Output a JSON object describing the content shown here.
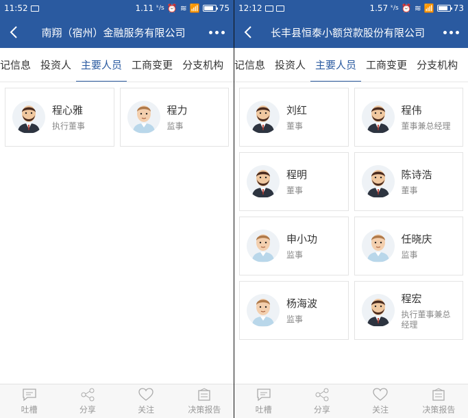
{
  "left": {
    "status": {
      "time": "11:52",
      "speed": "1.11",
      "battery": "75"
    },
    "nav": {
      "title": "南翔（宿州）金融服务有限公司"
    },
    "tabs": [
      "记信息",
      "投资人",
      "主要人员",
      "工商变更",
      "分支机构"
    ],
    "active_tab": "主要人员",
    "people": [
      {
        "name": "程心雅",
        "role": "执行董事",
        "avatar": "bearded-man-avatar-icon"
      },
      {
        "name": "程力",
        "role": "监事",
        "avatar": "young-man-avatar-icon"
      }
    ]
  },
  "right": {
    "status": {
      "time": "12:12",
      "speed": "1.57",
      "battery": "73"
    },
    "nav": {
      "title": "长丰县恒泰小额贷款股份有限公司"
    },
    "tabs": [
      "记信息",
      "投资人",
      "主要人员",
      "工商变更",
      "分支机构"
    ],
    "active_tab": "主要人员",
    "people": [
      {
        "name": "刘红",
        "role": "董事",
        "avatar": "bearded-man-avatar-icon"
      },
      {
        "name": "程伟",
        "role": "董事兼总经理",
        "avatar": "bearded-man-avatar-icon"
      },
      {
        "name": "程明",
        "role": "董事",
        "avatar": "bearded-man-avatar-icon"
      },
      {
        "name": "陈诗浩",
        "role": "董事",
        "avatar": "bearded-man-avatar-icon"
      },
      {
        "name": "申小功",
        "role": "监事",
        "avatar": "young-man-avatar-icon"
      },
      {
        "name": "任晓庆",
        "role": "监事",
        "avatar": "young-man-avatar-icon"
      },
      {
        "name": "杨海波",
        "role": "监事",
        "avatar": "young-man-avatar-icon"
      },
      {
        "name": "程宏",
        "role": "执行董事兼总经理",
        "avatar": "bearded-man-avatar-icon"
      }
    ]
  },
  "bottom_bar": {
    "items": [
      {
        "label": "吐槽",
        "icon": "chat-icon"
      },
      {
        "label": "分享",
        "icon": "share-icon"
      },
      {
        "label": "关注",
        "icon": "heart-icon"
      },
      {
        "label": "决策报告",
        "icon": "report-icon"
      }
    ]
  },
  "colors": {
    "primary": "#2a5aa0",
    "text": "#333333",
    "muted": "#888888"
  }
}
